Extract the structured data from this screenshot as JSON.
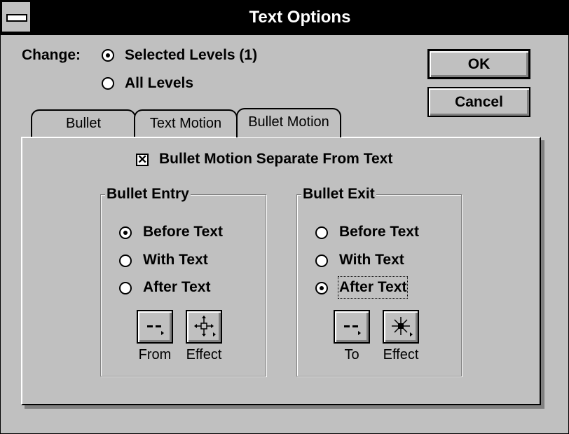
{
  "window": {
    "title": "Text Options"
  },
  "change": {
    "label": "Change:",
    "options": [
      {
        "label": "Selected Levels (1)",
        "selected": true
      },
      {
        "label": "All Levels",
        "selected": false
      }
    ]
  },
  "buttons": {
    "ok": "OK",
    "cancel": "Cancel"
  },
  "tabs": [
    {
      "label": "Bullet",
      "active": false
    },
    {
      "label": "Text Motion",
      "active": false
    },
    {
      "label": "Bullet Motion",
      "active": true
    }
  ],
  "bullet_motion": {
    "separate_checkbox": {
      "label": "Bullet Motion Separate From Text",
      "checked": true
    },
    "entry": {
      "title": "Bullet Entry",
      "options": [
        {
          "label": "Before Text",
          "selected": true
        },
        {
          "label": "With Text",
          "selected": false
        },
        {
          "label": "After Text",
          "selected": false
        }
      ],
      "from_label": "From",
      "effect_label": "Effect"
    },
    "exit": {
      "title": "Bullet Exit",
      "options": [
        {
          "label": "Before Text",
          "selected": false
        },
        {
          "label": "With Text",
          "selected": false
        },
        {
          "label": "After Text",
          "selected": true
        }
      ],
      "to_label": "To",
      "effect_label": "Effect"
    }
  }
}
